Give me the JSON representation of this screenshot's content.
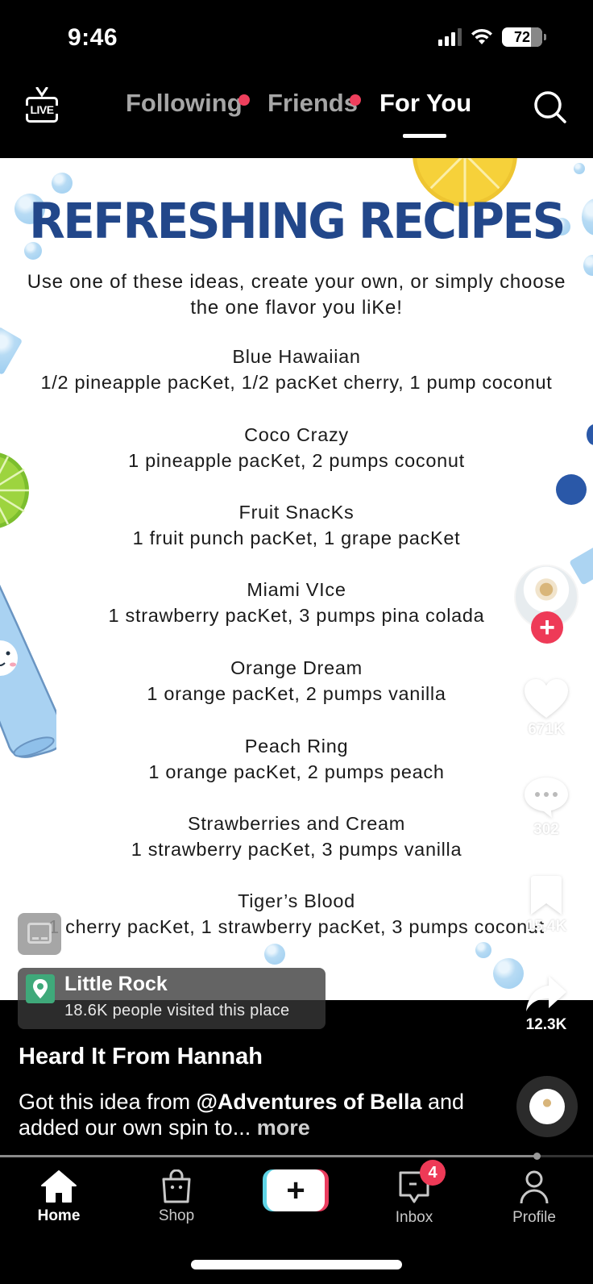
{
  "status_bar": {
    "time": "9:46",
    "battery": "72",
    "signal_bars_active": 3,
    "signal_bars_total": 4
  },
  "top_nav": {
    "live_label": "LIVE",
    "tabs": [
      {
        "label": "Following",
        "has_dot": true,
        "active": false
      },
      {
        "label": "Friends",
        "has_dot": true,
        "active": false
      },
      {
        "label": "For You",
        "has_dot": false,
        "active": true
      }
    ],
    "search_icon": "search-icon"
  },
  "video": {
    "title": "REFRESHING RECIPES",
    "subtitle": "Use one of these ideas, create your own, or simply choose the one flavor you liKe!",
    "recipes": [
      {
        "name": "Blue Hawaiian",
        "ingredients": "1/2 pineapple pacKet, 1/2 pacKet cherry, 1 pump coconut"
      },
      {
        "name": "Coco Crazy",
        "ingredients": "1 pineapple pacKet, 2 pumps coconut"
      },
      {
        "name": "Fruit SnacKs",
        "ingredients": "1 fruit punch pacKet, 1 grape pacKet"
      },
      {
        "name": "Miami VIce",
        "ingredients": "1 strawberry pacKet, 3 pumps pina colada"
      },
      {
        "name": "Orange Dream",
        "ingredients": "1 orange pacKet, 2 pumps vanilla"
      },
      {
        "name": "Peach Ring",
        "ingredients": "1 orange pacKet, 2 pumps peach"
      },
      {
        "name": "Strawberries and Cream",
        "ingredients": "1 strawberry pacKet, 3 pumps vanilla"
      },
      {
        "name": "Tiger’s Blood",
        "ingredients": "1 cherry pacKet, 1 strawberry pacKet, 3 pumps coconut"
      }
    ],
    "colors": {
      "title": "#22478a",
      "lemon": "#f6d13a",
      "lime": "#9dd43f",
      "bubble": "#9ccdf0"
    }
  },
  "actions": {
    "follow_label": "+",
    "likes": "671K",
    "comments": "302",
    "bookmarks": "15.4K",
    "shares": "12.3K"
  },
  "location": {
    "name": "Little Rock",
    "visits": "18.6K people visited this place"
  },
  "post": {
    "author": "Heard It From Hannah",
    "caption_prefix": "Got this idea from ",
    "mention": "@Adventures of Bella",
    "caption_suffix": " and added our own spin to...",
    "more_label": "more"
  },
  "progress": {
    "fraction": 0.905
  },
  "bottom_nav": {
    "items": [
      {
        "label": "Home",
        "active": true
      },
      {
        "label": "Shop",
        "active": false
      },
      {
        "label": "",
        "active": false
      },
      {
        "label": "Inbox",
        "active": false,
        "badge": "4"
      },
      {
        "label": "Profile",
        "active": false
      }
    ],
    "create_label": "+"
  },
  "accent": "#ee3a57"
}
